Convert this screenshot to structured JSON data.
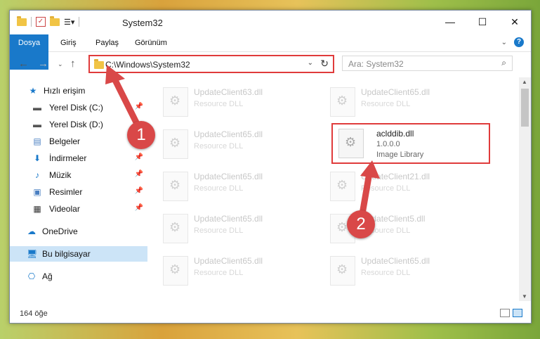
{
  "window": {
    "title": "System32"
  },
  "ribbon": {
    "tabs": [
      "Dosya",
      "Giriş",
      "Paylaş",
      "Görünüm"
    ]
  },
  "address": {
    "path": "C:\\Windows\\System32"
  },
  "search": {
    "placeholder": "Ara: System32"
  },
  "sidebar": {
    "items": [
      {
        "label": "Hızlı erişim",
        "icon": "star-icon",
        "pinned": false
      },
      {
        "label": "Yerel Disk (C:)",
        "icon": "drive-icon",
        "pinned": true
      },
      {
        "label": "Yerel Disk (D:)",
        "icon": "drive-icon",
        "pinned": false
      },
      {
        "label": "Belgeler",
        "icon": "documents-icon",
        "pinned": true
      },
      {
        "label": "İndirmeler",
        "icon": "download-icon",
        "pinned": true
      },
      {
        "label": "Müzik",
        "icon": "music-icon",
        "pinned": true
      },
      {
        "label": "Resimler",
        "icon": "pictures-icon",
        "pinned": true
      },
      {
        "label": "Videolar",
        "icon": "videos-icon",
        "pinned": true
      },
      {
        "label": "OneDrive",
        "icon": "cloud-icon",
        "pinned": false
      },
      {
        "label": "Bu bilgisayar",
        "icon": "computer-icon",
        "pinned": false
      },
      {
        "label": "Ağ",
        "icon": "network-icon",
        "pinned": false
      }
    ]
  },
  "files": [
    {
      "name": "UpdateClient63.dll",
      "desc": "Resource DLL"
    },
    {
      "name": "UpdateClient65.dll",
      "desc": "Resource DLL"
    },
    {
      "name": "UpdateClient65.dll",
      "desc": "Resource DLL"
    },
    {
      "name": "UpdateClient65.dll",
      "desc": "Resource DLL"
    },
    {
      "name": "UpdateClient21.dll",
      "desc": "Resource DLL"
    },
    {
      "name": "UpdateClient65.dll",
      "desc": "Resource DLL"
    },
    {
      "name": "UpdateClient5.dll",
      "desc": "Resource DLL"
    },
    {
      "name": "UpdateClient65.dll",
      "desc": "Resource DLL"
    },
    {
      "name": "UpdateClient65.dll",
      "desc": "Resource DLL"
    }
  ],
  "highlighted_file": {
    "name": "aclddib.dll",
    "version": "1.0.0.0",
    "type": "Image Library"
  },
  "status": {
    "item_count": "164 öğe"
  },
  "annotations": {
    "badge1": "1",
    "badge2": "2",
    "accent_color": "#d94848"
  }
}
